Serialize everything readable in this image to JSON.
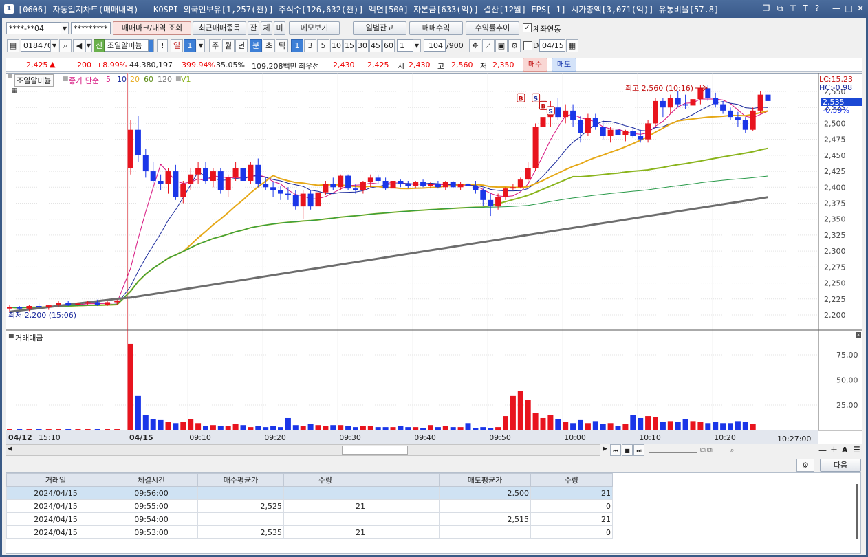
{
  "window": {
    "title": "[0606] 자동일지차트(매매내역) - KOSPI 외국인보유[1,257(천)] 주식수[126,632(천)] 액면[500] 자본금[633(억)] 결산[12월] EPS[-1] 시가총액[3,071(억)] 유통비율[57.8]",
    "icon": "1",
    "controls": [
      "❐",
      "⧉",
      "⊤",
      "T",
      "?",
      "—",
      "□",
      "✕"
    ]
  },
  "toolbar1": {
    "account": "****-**04",
    "password": "*********",
    "btn_trade_mark": "매매마크/내역 조회",
    "btn_recent": "최근매매종목",
    "btn_jan": "잔",
    "btn_che": "체",
    "btn_mi": "미",
    "btn_memo": "메모보기",
    "btn_daily_balance": "일별잔고",
    "btn_trade_profit": "매매수익",
    "btn_return_trend": "수익률추이",
    "account_link_label": "계좌연동"
  },
  "toolbar2": {
    "code": "018470",
    "shin": "신",
    "stock_name": "조일알미늄",
    "excl": "!",
    "periods": [
      "일",
      "1",
      "주",
      "월",
      "년",
      "분",
      "초",
      "틱"
    ],
    "minutes": [
      "1",
      "3",
      "5",
      "10",
      "15",
      "30",
      "45",
      "60"
    ],
    "count_select": "1",
    "count": "104",
    "count_total": "/900",
    "d_label": "D",
    "date": "04/15"
  },
  "quote": {
    "price": "2,425",
    "arrow": "▲",
    "change": "200",
    "change_pct": "+8.99%",
    "volume": "44,380,197",
    "vol_ratio": "399.94%",
    "turnover": "35.05%",
    "amount": "109,208백만",
    "pref_label": "최우선",
    "ask": "2,430",
    "bid": "2,425",
    "open_label": "시",
    "open": "2,430",
    "high_label": "고",
    "high": "2,560",
    "low_label": "저",
    "low": "2,350",
    "buy": "매수",
    "sell": "매도"
  },
  "chart": {
    "legend_name": "조일알미늄",
    "legend_ma_label": "종가 단순",
    "legend_ma": [
      "5",
      "10",
      "20",
      "60",
      "120"
    ],
    "legend_v": "V1",
    "high_annot": "최고 2,560 (10:16)",
    "low_annot": "최저 2,200 (15:06)",
    "lc": "LC:15.23",
    "hc": "HC:-0.98",
    "cur_price": "2,535",
    "cur_pct": "-0.59%",
    "volume_title": "거래대금",
    "price_ticks": [
      "2,550",
      "2,525",
      "2,500",
      "2,475",
      "2,450",
      "2,425",
      "2,400",
      "2,375",
      "2,350",
      "2,325",
      "2,300",
      "2,275",
      "2,250",
      "2,225",
      "2,200"
    ],
    "vol_ticks": [
      "75,00",
      "50,00",
      "25,00"
    ],
    "time_labels": [
      "04/12",
      "15:10",
      "04/15",
      "09:10",
      "09:20",
      "09:30",
      "09:40",
      "09:50",
      "10:00",
      "10:10",
      "10:20"
    ],
    "end_time": "10:27:00",
    "colors": {
      "up": "#e8141e",
      "down": "#1b36e8",
      "ma5": "#d6127e",
      "ma10": "#1a2a9c",
      "ma20": "#e6a817",
      "ma60": "#8ab41c",
      "ma120": "#2a9a4a",
      "v1": "#6d6d6d"
    },
    "markers": [
      "B",
      "S",
      "B",
      "S"
    ]
  },
  "chart_data": {
    "type": "candlestick",
    "x_labels_shown": [
      "04/12",
      "15:10",
      "04/15",
      "09:10",
      "09:20",
      "09:30",
      "09:40",
      "09:50",
      "10:00",
      "10:10",
      "10:20"
    ],
    "ylim": [
      2190,
      2565
    ],
    "candles": [
      [
        2210,
        2215,
        2205,
        2212
      ],
      [
        2212,
        2214,
        2208,
        2210
      ],
      [
        2210,
        2216,
        2206,
        2214
      ],
      [
        2214,
        2218,
        2210,
        2212
      ],
      [
        2212,
        2216,
        2208,
        2215
      ],
      [
        2215,
        2222,
        2212,
        2219
      ],
      [
        2219,
        2222,
        2214,
        2216
      ],
      [
        2216,
        2220,
        2212,
        2218
      ],
      [
        2218,
        2222,
        2215,
        2220
      ],
      [
        2220,
        2224,
        2214,
        2216
      ],
      [
        2216,
        2222,
        2214,
        2220
      ],
      [
        2220,
        2224,
        2216,
        2222
      ],
      [
        2430,
        2505,
        2420,
        2490
      ],
      [
        2490,
        2512,
        2440,
        2450
      ],
      [
        2450,
        2460,
        2415,
        2425
      ],
      [
        2425,
        2440,
        2405,
        2410
      ],
      [
        2410,
        2420,
        2395,
        2405
      ],
      [
        2405,
        2430,
        2390,
        2425
      ],
      [
        2425,
        2435,
        2380,
        2385
      ],
      [
        2385,
        2410,
        2375,
        2405
      ],
      [
        2405,
        2430,
        2395,
        2420
      ],
      [
        2420,
        2440,
        2405,
        2430
      ],
      [
        2430,
        2440,
        2405,
        2410
      ],
      [
        2410,
        2430,
        2400,
        2425
      ],
      [
        2425,
        2430,
        2390,
        2395
      ],
      [
        2395,
        2420,
        2385,
        2415
      ],
      [
        2415,
        2440,
        2410,
        2430
      ],
      [
        2430,
        2440,
        2405,
        2410
      ],
      [
        2410,
        2440,
        2405,
        2435
      ],
      [
        2435,
        2445,
        2400,
        2405
      ],
      [
        2405,
        2415,
        2395,
        2400
      ],
      [
        2400,
        2408,
        2385,
        2395
      ],
      [
        2395,
        2402,
        2380,
        2390
      ],
      [
        2390,
        2400,
        2380,
        2388
      ],
      [
        2388,
        2395,
        2365,
        2370
      ],
      [
        2370,
        2395,
        2350,
        2390
      ],
      [
        2390,
        2395,
        2365,
        2370
      ],
      [
        2370,
        2395,
        2365,
        2392
      ],
      [
        2392,
        2410,
        2388,
        2405
      ],
      [
        2405,
        2415,
        2395,
        2400
      ],
      [
        2400,
        2420,
        2395,
        2418
      ],
      [
        2418,
        2420,
        2395,
        2398
      ],
      [
        2398,
        2405,
        2390,
        2395
      ],
      [
        2395,
        2410,
        2390,
        2408
      ],
      [
        2408,
        2420,
        2400,
        2415
      ],
      [
        2415,
        2420,
        2405,
        2410
      ],
      [
        2410,
        2415,
        2395,
        2398
      ],
      [
        2398,
        2412,
        2395,
        2410
      ],
      [
        2410,
        2412,
        2400,
        2405
      ],
      [
        2405,
        2410,
        2398,
        2402
      ],
      [
        2402,
        2410,
        2398,
        2408
      ],
      [
        2408,
        2412,
        2400,
        2402
      ],
      [
        2402,
        2408,
        2398,
        2405
      ],
      [
        2405,
        2410,
        2398,
        2400
      ],
      [
        2400,
        2410,
        2396,
        2408
      ],
      [
        2408,
        2410,
        2398,
        2400
      ],
      [
        2400,
        2408,
        2395,
        2405
      ],
      [
        2405,
        2410,
        2398,
        2402
      ],
      [
        2402,
        2410,
        2390,
        2395
      ],
      [
        2395,
        2398,
        2370,
        2380
      ],
      [
        2380,
        2390,
        2355,
        2370
      ],
      [
        2370,
        2390,
        2365,
        2385
      ],
      [
        2385,
        2400,
        2380,
        2398
      ],
      [
        2398,
        2405,
        2395,
        2400
      ],
      [
        2400,
        2415,
        2398,
        2412
      ],
      [
        2412,
        2440,
        2408,
        2430
      ],
      [
        2430,
        2500,
        2425,
        2495
      ],
      [
        2495,
        2525,
        2480,
        2510
      ],
      [
        2510,
        2535,
        2495,
        2525
      ],
      [
        2525,
        2540,
        2505,
        2510
      ],
      [
        2510,
        2530,
        2500,
        2520
      ],
      [
        2520,
        2530,
        2495,
        2505
      ],
      [
        2505,
        2512,
        2470,
        2485
      ],
      [
        2485,
        2515,
        2480,
        2508
      ],
      [
        2508,
        2515,
        2490,
        2495
      ],
      [
        2495,
        2505,
        2475,
        2480
      ],
      [
        2480,
        2495,
        2470,
        2490
      ],
      [
        2490,
        2495,
        2478,
        2482
      ],
      [
        2482,
        2490,
        2472,
        2488
      ],
      [
        2488,
        2495,
        2478,
        2480
      ],
      [
        2480,
        2490,
        2470,
        2475
      ],
      [
        2475,
        2505,
        2470,
        2500
      ],
      [
        2500,
        2540,
        2495,
        2535
      ],
      [
        2535,
        2540,
        2510,
        2525
      ],
      [
        2525,
        2545,
        2515,
        2540
      ],
      [
        2540,
        2550,
        2525,
        2530
      ],
      [
        2530,
        2545,
        2522,
        2528
      ],
      [
        2528,
        2545,
        2520,
        2538
      ],
      [
        2538,
        2560,
        2530,
        2555
      ],
      [
        2555,
        2560,
        2535,
        2540
      ],
      [
        2540,
        2548,
        2525,
        2530
      ],
      [
        2530,
        2535,
        2515,
        2520
      ],
      [
        2520,
        2525,
        2505,
        2510
      ],
      [
        2510,
        2518,
        2495,
        2505
      ],
      [
        2505,
        2510,
        2485,
        2490
      ],
      [
        2490,
        2525,
        2488,
        2520
      ],
      [
        2520,
        2550,
        2515,
        2545
      ],
      [
        2545,
        2560,
        2525,
        2535
      ]
    ],
    "volumes": [
      1,
      1,
      1,
      1,
      1,
      1,
      1,
      1,
      1,
      1,
      1,
      1,
      86,
      34,
      15,
      11,
      10,
      8,
      7,
      8,
      11,
      7,
      4,
      5,
      4,
      4,
      6,
      5,
      3,
      4,
      3,
      4,
      3,
      12,
      5,
      4,
      6,
      5,
      4,
      5,
      5,
      4,
      3,
      4,
      4,
      3,
      3,
      3,
      4,
      3,
      3,
      2,
      5,
      3,
      4,
      3,
      3,
      7,
      2,
      3,
      2,
      3,
      14,
      34,
      39,
      30,
      17,
      12,
      15,
      11,
      8,
      7,
      10,
      7,
      9,
      6,
      7,
      4,
      6,
      15,
      12,
      14,
      13,
      8,
      9,
      8,
      11,
      9,
      8,
      7,
      8,
      7,
      7,
      9,
      8,
      6
    ]
  },
  "history": {
    "headers": [
      "거래일",
      "체결시간",
      "매수평균가",
      "수량",
      "",
      "매도평균가",
      "수량"
    ],
    "rows": [
      [
        "2024/04/15",
        "09:56:00",
        "",
        "",
        "",
        "2,500",
        "21"
      ],
      [
        "2024/04/15",
        "09:55:00",
        "2,525",
        "21",
        "",
        "",
        "0"
      ],
      [
        "2024/04/15",
        "09:54:00",
        "",
        "",
        "",
        "2,515",
        "21"
      ],
      [
        "2024/04/15",
        "09:53:00",
        "2,535",
        "21",
        "",
        "",
        "0"
      ]
    ],
    "next": "다음"
  }
}
